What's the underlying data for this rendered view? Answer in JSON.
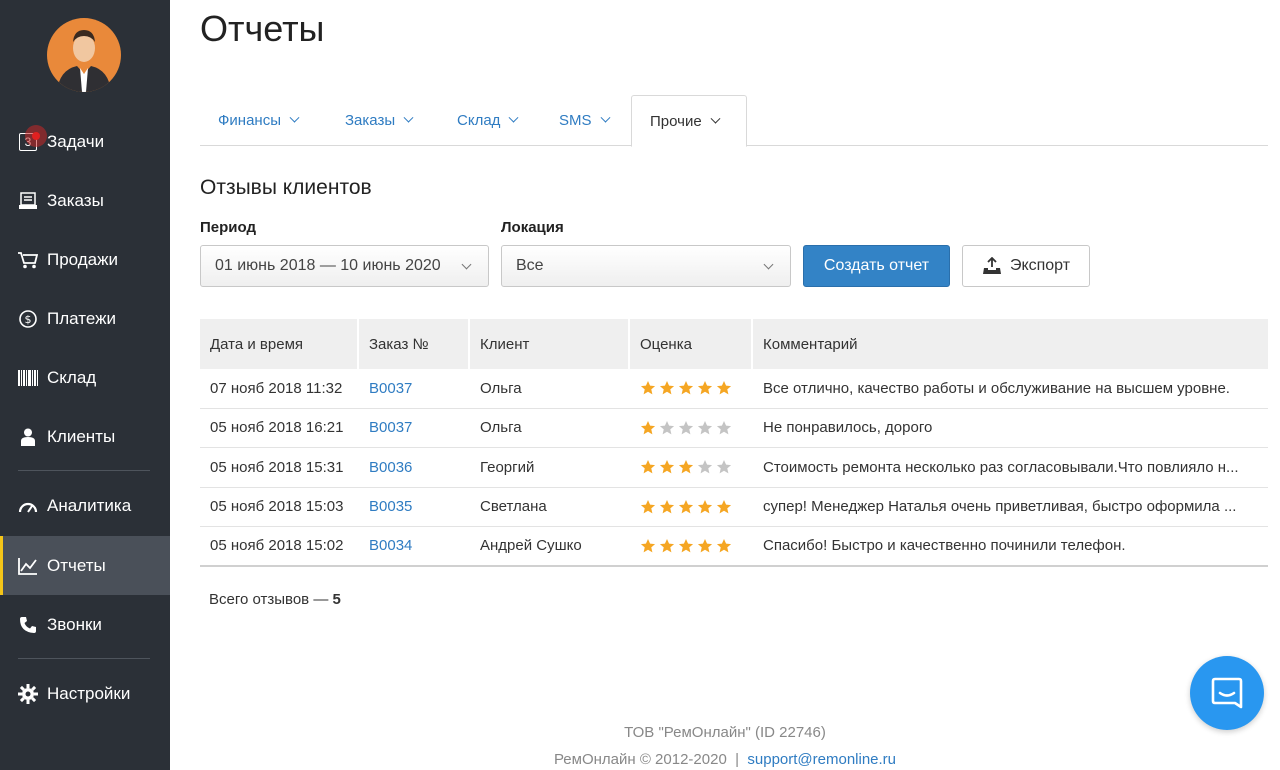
{
  "sidebar": {
    "items": [
      {
        "label": "Задачи",
        "icon": "tasks-icon",
        "badge": "3"
      },
      {
        "label": "Заказы",
        "icon": "orders-icon"
      },
      {
        "label": "Продажи",
        "icon": "cart-icon"
      },
      {
        "label": "Платежи",
        "icon": "dollar-icon"
      },
      {
        "label": "Склад",
        "icon": "barcode-icon"
      },
      {
        "label": "Клиенты",
        "icon": "person-icon"
      },
      {
        "label": "Аналитика",
        "icon": "gauge-icon"
      },
      {
        "label": "Отчеты",
        "icon": "chart-line-icon",
        "active": true
      },
      {
        "label": "Звонки",
        "icon": "phone-icon"
      },
      {
        "label": "Настройки",
        "icon": "gear-icon"
      }
    ]
  },
  "page": {
    "title": "Отчеты"
  },
  "tabs": [
    {
      "label": "Финансы"
    },
    {
      "label": "Заказы"
    },
    {
      "label": "Склад"
    },
    {
      "label": "SMS"
    },
    {
      "label": "Прочие",
      "active": true
    }
  ],
  "report": {
    "title": "Отзывы клиентов",
    "period_label": "Период",
    "period_value": "01 июнь 2018 — 10 июнь 2020",
    "location_label": "Локация",
    "location_value": "Все",
    "create_button": "Создать отчет",
    "export_button": "Экспорт"
  },
  "table": {
    "headers": [
      "Дата и время",
      "Заказ №",
      "Клиент",
      "Оценка",
      "Комментарий"
    ],
    "rows": [
      {
        "date": "07 нояб 2018 11:32",
        "order": "B0037",
        "client": "Ольга",
        "rating": 5,
        "comment": "Все отлично, качество работы и обслуживание на высшем уровне."
      },
      {
        "date": "05 нояб 2018 16:21",
        "order": "B0037",
        "client": "Ольга",
        "rating": 1,
        "comment": "Не понравилось, дорого"
      },
      {
        "date": "05 нояб 2018 15:31",
        "order": "B0036",
        "client": "Георгий",
        "rating": 3,
        "comment": "Стоимость ремонта несколько раз согласовывали.Что повлияло н..."
      },
      {
        "date": "05 нояб 2018 15:03",
        "order": "B0035",
        "client": "Светлана",
        "rating": 5,
        "comment": "супер! Менеджер Наталья очень приветливая, быстро оформила ..."
      },
      {
        "date": "05 нояб 2018 15:02",
        "order": "B0034",
        "client": "Андрей Сушко",
        "rating": 5,
        "comment": "Спасибо! Быстро и качественно починили телефон."
      }
    ]
  },
  "summary": {
    "label": "Всего отзывов — ",
    "count": "5"
  },
  "footer": {
    "company": "ТОВ \"РемОнлайн\" (ID 22746)",
    "copyright": "РемОнлайн © 2012-2020",
    "separator": "|",
    "email": "support@remonline.ru"
  },
  "colors": {
    "accent": "#3383c6",
    "star_on": "#f5a623",
    "star_off": "#c4c4c4",
    "sidebar": "#2b3037",
    "active_marker": "#f5c518"
  }
}
